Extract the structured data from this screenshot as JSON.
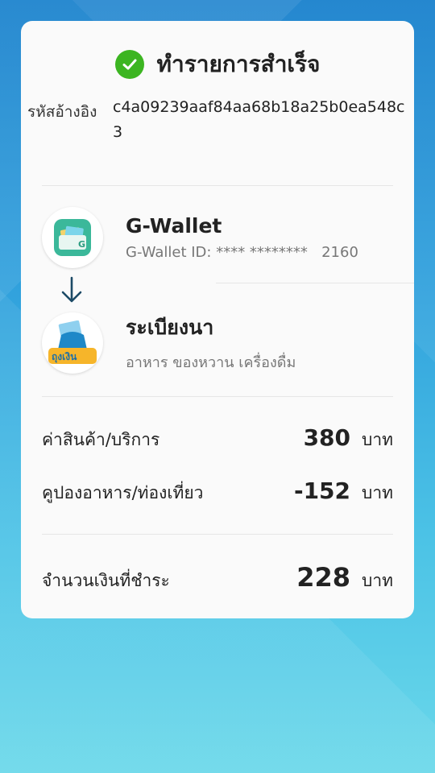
{
  "header": {
    "title": "ทำรายการสำเร็จ",
    "status_icon": "check-circle-icon",
    "status_color": "#3cb521"
  },
  "reference": {
    "label": "รหัสอ้างอิง",
    "value": "c4a09239aaf84aa68b18a25b0ea548c3"
  },
  "from": {
    "name": "G-Wallet",
    "detail": "G-Wallet ID: **** ********   2160",
    "logo": "g-wallet-logo"
  },
  "to": {
    "name": "ระเบียงนา",
    "detail": "อาหาร ของหวาน เครื่องดื่ม",
    "logo": "thung-ngoen-logo",
    "logo_text": "ถุงเงิน"
  },
  "summary": {
    "items": [
      {
        "label": "ค่าสินค้า/บริการ",
        "amount": "380",
        "unit": "บาท"
      },
      {
        "label": "คูปองอาหาร/ท่องเที่ยว",
        "amount": "-152",
        "unit": "บาท"
      }
    ],
    "total": {
      "label": "จำนวนเงินที่ชำระ",
      "amount": "228",
      "unit": "บาท"
    }
  }
}
